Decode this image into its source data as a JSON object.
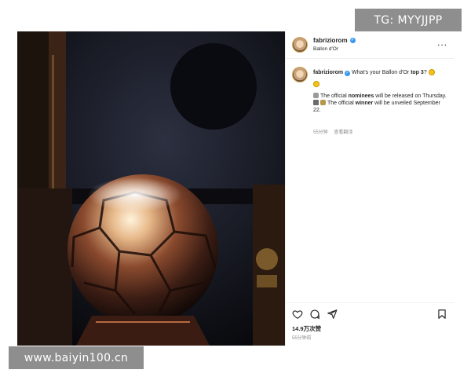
{
  "watermarks": {
    "top": "TG: MYYJJPP",
    "bottom": "www.baiyin100.cn"
  },
  "post": {
    "header": {
      "username": "fabriziorom",
      "subtitle": "Ballon d'Or",
      "more_label": "..."
    },
    "caption": {
      "username": "fabriziorom",
      "text_before": "What's your Ballon d'Or ",
      "text_bold": "top 3",
      "text_after": "?",
      "line2_a": "The official ",
      "line2_bold": "nominees",
      "line2_b": " will be released on Thursday.",
      "line3_a": "The official ",
      "line3_bold": "winner",
      "line3_b": " will be unveiled September 22.",
      "meta_time": "55分钟",
      "meta_translate": "查看翻译"
    },
    "actions": {
      "likes": "14.9万次赞",
      "time": "55分钟前",
      "icons": [
        "heart-icon",
        "comment-icon",
        "share-icon",
        "bookmark-icon"
      ]
    }
  },
  "colors": {
    "verified": "#3897f0",
    "text": "#262626",
    "muted": "#8e8e8e"
  }
}
